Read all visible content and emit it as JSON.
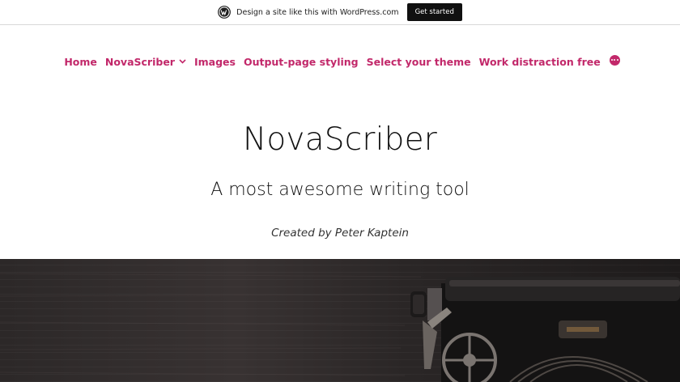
{
  "promo_bar": {
    "text": "Design a site like this with WordPress.com",
    "button_label": "Get started"
  },
  "nav": {
    "items": [
      {
        "label": "Home"
      },
      {
        "label": "NovaScriber",
        "has_submenu": true
      },
      {
        "label": "Images"
      },
      {
        "label": "Output-page styling"
      },
      {
        "label": "Select your theme"
      },
      {
        "label": "Work distraction free"
      }
    ],
    "more_icon": "more-horizontal-icon",
    "color": "#c2286a"
  },
  "header": {
    "title": "NovaScriber",
    "tagline": "A most awesome writing tool",
    "byline": "Created by Peter Kaptein"
  },
  "hero": {
    "image": "typewriter-on-dark-wooden-table"
  }
}
